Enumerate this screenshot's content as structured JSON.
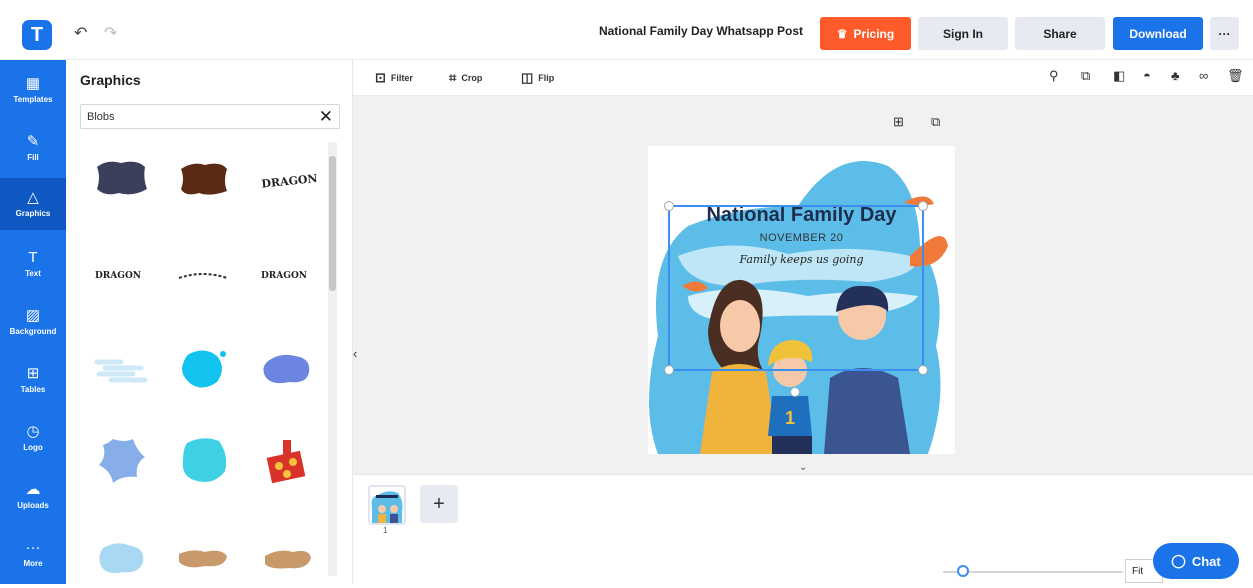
{
  "app": {
    "logo_letter": "T",
    "brand_color": "#1a73e8"
  },
  "header": {
    "undo_icon": "undo-icon",
    "redo_icon": "redo-icon",
    "doc_title": "National Family Day Whatsapp Post",
    "pricing": "Pricing",
    "signin": "Sign In",
    "share": "Share",
    "download": "Download",
    "more": "···"
  },
  "sidebar": {
    "items": [
      {
        "label": "Templates",
        "icon": "templates-icon",
        "glyph": "▦"
      },
      {
        "label": "Fill",
        "icon": "pencil-icon",
        "glyph": "✎"
      },
      {
        "label": "Graphics",
        "icon": "shapes-icon",
        "glyph": "△",
        "active": true
      },
      {
        "label": "Text",
        "icon": "text-icon",
        "glyph": "T"
      },
      {
        "label": "Background",
        "icon": "background-icon",
        "glyph": "▨"
      },
      {
        "label": "Tables",
        "icon": "table-icon",
        "glyph": "⊞"
      },
      {
        "label": "Logo",
        "icon": "logo-icon",
        "glyph": "◷"
      },
      {
        "label": "Uploads",
        "icon": "upload-cloud-icon",
        "glyph": "☁"
      },
      {
        "label": "More",
        "icon": "more-icon",
        "glyph": "···"
      }
    ]
  },
  "panel": {
    "title": "Graphics",
    "search_value": "Blobs",
    "clear_glyph": "✕"
  },
  "toolbar": {
    "filter": "Filter",
    "crop": "Crop",
    "flip": "Flip"
  },
  "poster": {
    "title": "National Family Day",
    "date": "NOVEMBER 20",
    "tagline": "Family keeps us going",
    "jersey_number": "1"
  },
  "pages": {
    "current_number": "1",
    "add_glyph": "+"
  },
  "zoom": {
    "fit_label": "Fit"
  },
  "chat": {
    "label": "Chat"
  },
  "colors": {
    "pricing": "#ff5a2a",
    "download": "#1a73e8",
    "canvas_bg": "#f1f1f1"
  }
}
